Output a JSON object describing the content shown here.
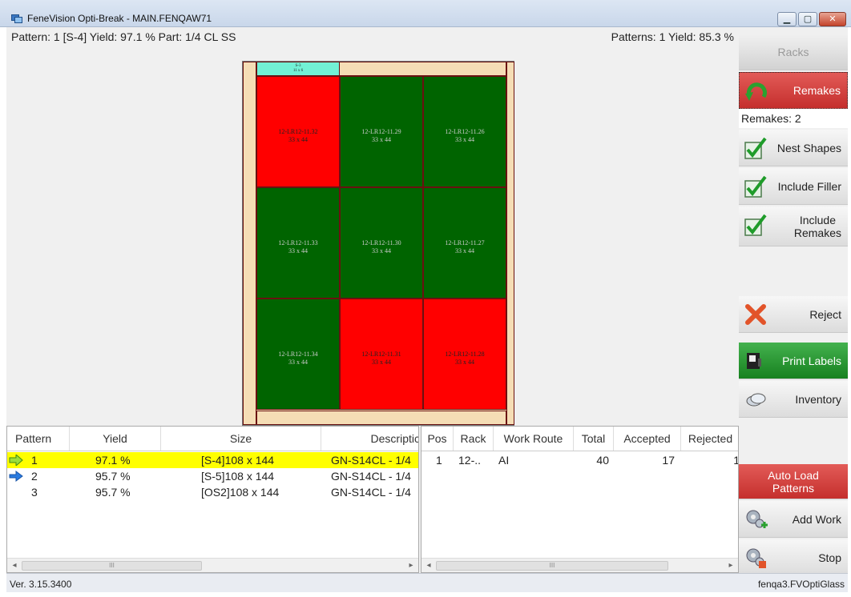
{
  "window": {
    "title": "FeneVision Opti-Break - MAIN.FENQAW71"
  },
  "info_bar": {
    "left": "Pattern: 1  [S-4]  Yield: 97.1 %  Part: 1/4 CL SS",
    "right": "Patterns: 1  Yield: 85.3 %"
  },
  "sheet": {
    "filler": {
      "label_line1": "S-3",
      "label_line2": "11 x 6"
    },
    "pieces": [
      {
        "id": "12-LR12-11.32",
        "size": "33 x 44",
        "color": "red"
      },
      {
        "id": "12-LR12-11.29",
        "size": "33 x 44",
        "color": "green"
      },
      {
        "id": "12-LR12-11.26",
        "size": "33 x 44",
        "color": "green"
      },
      {
        "id": "12-LR12-11.33",
        "size": "33 x 44",
        "color": "green"
      },
      {
        "id": "12-LR12-11.30",
        "size": "33 x 44",
        "color": "green"
      },
      {
        "id": "12-LR12-11.27",
        "size": "33 x 44",
        "color": "green"
      },
      {
        "id": "12-LR12-11.34",
        "size": "33 x 44",
        "color": "green"
      },
      {
        "id": "12-LR12-11.31",
        "size": "33 x 44",
        "color": "red"
      },
      {
        "id": "12-LR12-11.28",
        "size": "33 x 44",
        "color": "red"
      }
    ]
  },
  "patterns_grid": {
    "headers": {
      "pattern": "Pattern",
      "yield": "Yield",
      "size": "Size",
      "description": "Descriptic"
    },
    "rows": [
      {
        "pattern": "1",
        "yield": "97.1 %",
        "size": "[S-4]108 x 144",
        "description": "GN-S14CL - 1/4",
        "arrow": "green"
      },
      {
        "pattern": "2",
        "yield": "95.7 %",
        "size": "[S-5]108 x 144",
        "description": "GN-S14CL - 1/4",
        "arrow": "blue"
      },
      {
        "pattern": "3",
        "yield": "95.7 %",
        "size": "[OS2]108 x 144",
        "description": "GN-S14CL - 1/4",
        "arrow": ""
      }
    ],
    "scroll_grip": "III"
  },
  "work_grid": {
    "headers": {
      "pos": "Pos",
      "rack": "Rack",
      "work_route": "Work Route",
      "total": "Total",
      "accepted": "Accepted",
      "rejected": "Rejected"
    },
    "rows": [
      {
        "pos": "1",
        "rack": "12-..",
        "work_route": "AI",
        "total": "40",
        "accepted": "17",
        "rejected": "1"
      }
    ],
    "scroll_grip": "III"
  },
  "right_panel": {
    "racks": "Racks",
    "remakes": "Remakes",
    "remakes_count": "Remakes: 2",
    "nest_shapes": "Nest Shapes",
    "include_filler": "Include Filler",
    "include_remakes_line1": "Include",
    "include_remakes_line2": "Remakes",
    "reject": "Reject",
    "print_labels": "Print Labels",
    "inventory": "Inventory",
    "auto_load_line1": "Auto Load",
    "auto_load_line2": "Patterns",
    "add_work": "Add Work",
    "stop": "Stop"
  },
  "status_bar": {
    "left": "Ver. 3.15.3400",
    "right": "fenqa3.FVOptiGlass"
  },
  "colors": {
    "red": "#ff0000",
    "green": "#006400",
    "filler": "#72f1d5",
    "sheet": "#f5ddb5",
    "selected_row": "#ffff00"
  }
}
